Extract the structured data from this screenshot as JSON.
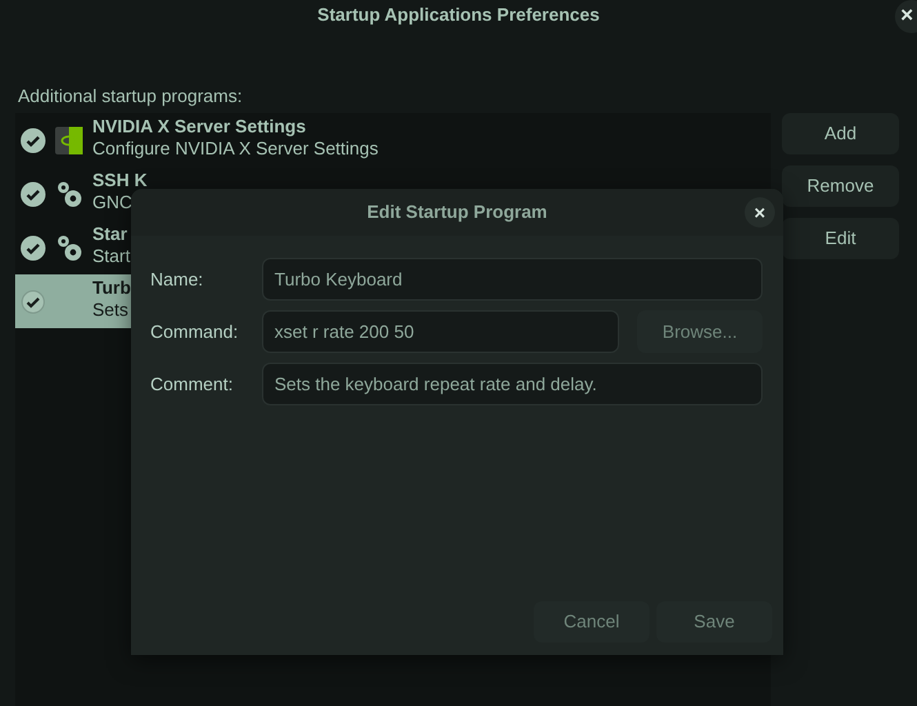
{
  "window": {
    "title": "Startup Applications Preferences",
    "close": "×"
  },
  "list_label": "Additional startup programs:",
  "programs": [
    {
      "name": "NVIDIA X Server Settings",
      "comment": "Configure NVIDIA X Server Settings",
      "checked": true,
      "selected": false,
      "kind": "nvidia"
    },
    {
      "name": "SSH K",
      "comment": "GNC",
      "checked": true,
      "selected": false,
      "kind": "gears"
    },
    {
      "name": "Star",
      "comment": "Start",
      "checked": true,
      "selected": false,
      "kind": "gears"
    },
    {
      "name": "Turb",
      "comment": "Sets",
      "checked": true,
      "selected": true,
      "kind": "plain"
    }
  ],
  "buttons": [
    "Add",
    "Remove",
    "Edit"
  ],
  "dialog": {
    "title": "Edit Startup Program",
    "close": "×",
    "fields": [
      {
        "label": "Name:",
        "value": "Turbo Keyboard"
      },
      {
        "label": "Command:",
        "value": "xset r rate 200 50",
        "button": "Browse..."
      },
      {
        "label": "Comment:",
        "value": "Sets the keyboard repeat rate and delay."
      }
    ],
    "buttons": [
      "Cancel",
      "Save"
    ]
  }
}
